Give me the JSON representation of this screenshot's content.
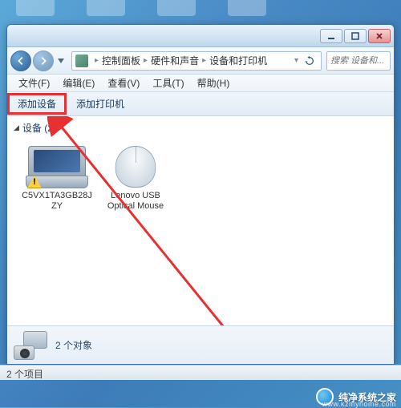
{
  "breadcrumb": {
    "parts": [
      "控制面板",
      "硬件和声音",
      "设备和打印机"
    ]
  },
  "search": {
    "placeholder": "搜索 设备和..."
  },
  "menubar": {
    "items": [
      "文件(F)",
      "编辑(E)",
      "查看(V)",
      "工具(T)",
      "帮助(H)"
    ]
  },
  "toolbar": {
    "add_device": "添加设备",
    "add_printer": "添加打印机"
  },
  "content": {
    "group_label": "设备 (2)",
    "devices": [
      {
        "name": "C5VX1TA3GB28JZY",
        "type": "laptop",
        "warning": true
      },
      {
        "name": "Lenovo USB Optical Mouse",
        "type": "mouse",
        "warning": false
      }
    ]
  },
  "details": {
    "text": "2 个对象"
  },
  "statusbar": {
    "text": "2 个项目"
  },
  "watermark": {
    "title": "纯净系统之家",
    "url": "www.kzmyhome.com"
  }
}
